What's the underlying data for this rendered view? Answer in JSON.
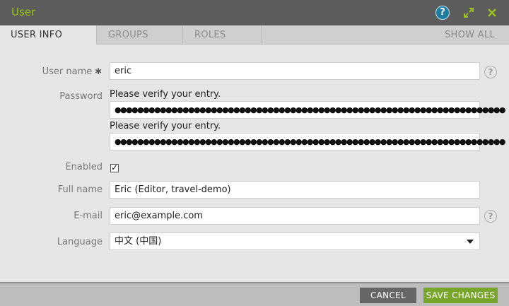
{
  "window": {
    "title": "User",
    "help_symbol": "?"
  },
  "tabs": [
    "USER INFO",
    "GROUPS",
    "ROLES",
    "SHOW ALL"
  ],
  "form": {
    "username": {
      "label": "User name",
      "required_mark": "∗",
      "value": "eric",
      "help_symbol": "?"
    },
    "password": {
      "label": "Password",
      "verify_hint_1": "Please verify your entry.",
      "masked_value_1": "●●●●●●●●●●●●●●●●●●●●●●●●●●●●●●●●●●●●●●●●●●●●●●●●●●●●●●●●●●●●●●●●●●●●●",
      "verify_hint_2": "Please verify your entry.",
      "masked_value_2": "●●●●●●●●●●●●●●●●●●●●●●●●●●●●●●●●●●●●●●●●●●●●●●●●●●●●●●●●●●●●●●●●●●●●●"
    },
    "enabled": {
      "label": "Enabled",
      "checked": true,
      "check_glyph": "✓"
    },
    "fullname": {
      "label": "Full name",
      "value": "Eric (Editor, travel-demo)"
    },
    "email": {
      "label": "E-mail",
      "value": "eric@example.com",
      "help_symbol": "?"
    },
    "language": {
      "label": "Language",
      "value": "中文 (中国)"
    }
  },
  "footer": {
    "cancel_label": "CANCEL",
    "save_label": "SAVE CHANGES"
  },
  "colors": {
    "accent": "#9ac219",
    "save": "#77a62a",
    "cancel": "#666666",
    "help": "#1f7c9e"
  },
  "icons": [
    "help-icon",
    "expand-icon",
    "close-icon",
    "field-help-icon",
    "dropdown-caret-icon",
    "checkmark-icon"
  ]
}
